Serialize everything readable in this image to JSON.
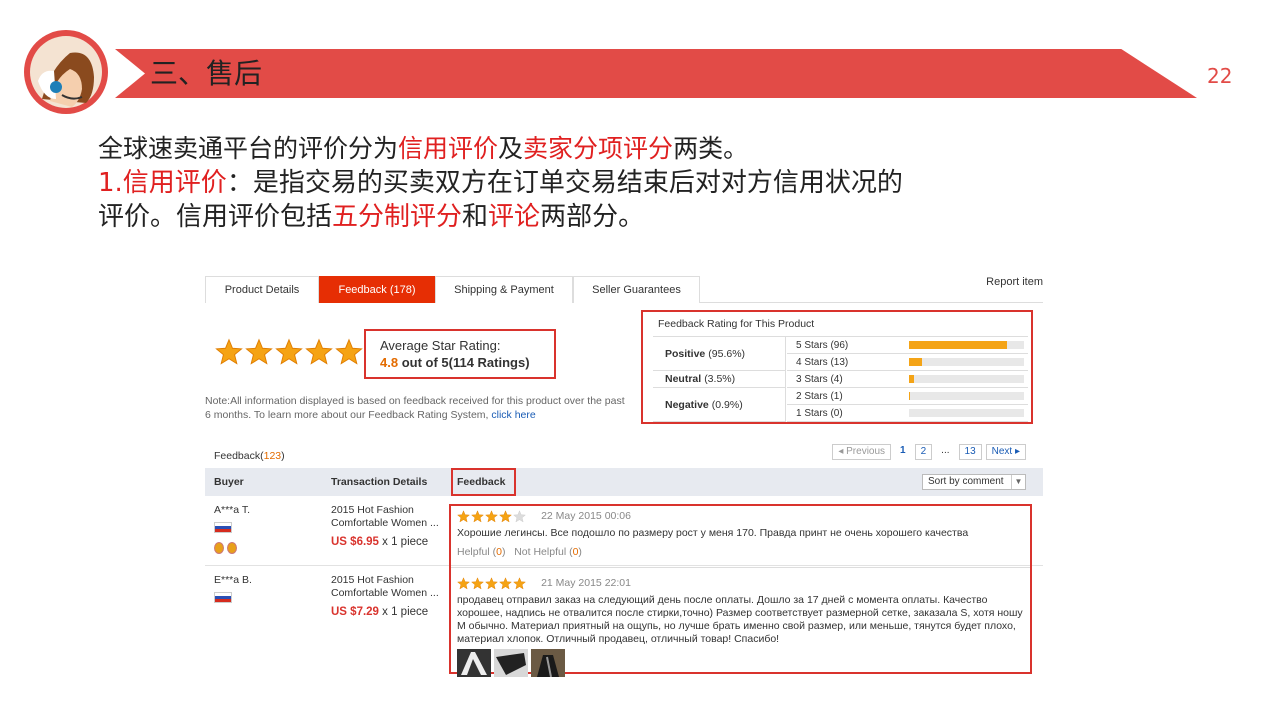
{
  "slide": {
    "title": "三、售后",
    "page_number": "22",
    "accent_color": "#e24b47"
  },
  "body": {
    "line1": [
      {
        "text": "全球速卖通平台的评价分为",
        "red": false
      },
      {
        "text": "信用评价",
        "red": true
      },
      {
        "text": "及",
        "red": false
      },
      {
        "text": "卖家分项评分",
        "red": true
      },
      {
        "text": "两类。",
        "red": false
      }
    ],
    "line2": [
      {
        "text": "1.信用评价",
        "red": true
      },
      {
        "text": "：是指交易的买卖双方在订单交易结束后对对方信用状况的",
        "red": false
      }
    ],
    "line3": [
      {
        "text": "评价。信用评价包括",
        "red": false
      },
      {
        "text": "五分制评分",
        "red": true
      },
      {
        "text": "和",
        "red": false
      },
      {
        "text": "评论",
        "red": true
      },
      {
        "text": "两部分。",
        "red": false
      }
    ]
  },
  "screenshot": {
    "tabs": [
      "Product Details",
      "Feedback (178)",
      "Shipping & Payment",
      "Seller Guarantees"
    ],
    "active_tab": 1,
    "report_link": "Report item",
    "average": {
      "label": "Average Star Rating:",
      "value": "4.8",
      "suffix": " out of 5(114 Ratings)",
      "stars": 5
    },
    "note": "Note:All information displayed is based on feedback received for this product over the past 6 months. To learn more about our Feedback Rating System, ",
    "note_link": "click here",
    "rating": {
      "title": "Feedback Rating for This Product",
      "groups": [
        {
          "name": "Positive",
          "pct": "(95.6%)"
        },
        {
          "name": "Neutral",
          "pct": "(3.5%)"
        },
        {
          "name": "Negative",
          "pct": "(0.9%)"
        }
      ],
      "stars": [
        {
          "label": "5 Stars (96)",
          "fraction": 0.85
        },
        {
          "label": "4 Stars (13)",
          "fraction": 0.11
        },
        {
          "label": "3 Stars (4)",
          "fraction": 0.04
        },
        {
          "label": "2 Stars (1)",
          "fraction": 0.01
        },
        {
          "label": "1 Stars (0)",
          "fraction": 0.0
        }
      ]
    },
    "feedback_count_label": "Feedback(",
    "feedback_count": "123",
    "feedback_count_close": ")",
    "pager": [
      "◂ Previous",
      "1",
      "2",
      "...",
      "13",
      "Next ▸"
    ],
    "columns": [
      "Buyer",
      "Transaction Details",
      "Feedback"
    ],
    "sort_label": "Sort by comment",
    "rows": [
      {
        "buyer": "A***a T.",
        "trans": "2015 Hot Fashion Comfortable Women ...",
        "price": "US $6.95",
        "qty": " x 1 piece",
        "stars": 4,
        "date": "22 May 2015 00:06",
        "text": "Хорошие легинсы. Все подошло по размеру рост у меня 170. Правда принт не очень хорошего качества",
        "helpful_label": "Helpful (",
        "helpful": "0",
        "close1": ")",
        "not_helpful_label": "Not Helpful (",
        "not_helpful": "0",
        "close2": ")"
      },
      {
        "buyer": "E***a B.",
        "trans": "2015 Hot Fashion Comfortable Women ...",
        "price": "US $7.29",
        "qty": " x 1 piece",
        "stars": 5,
        "date": "21 May 2015 22:01",
        "text": "продавец отправил заказ на следующий день после оплаты. Дошло за 17 дней с момента оплаты. Качество хорошее, надпись не отвалится после стирки,точно) Размер соответствует размерной сетке, заказала S, хотя ношу M обычно. Материал приятный на ощупь, но лучше брать именно свой размер, или меньше, тянутся будет плохо, материал хлопок. Отличный продавец, отличный товар! Спасибо!"
      }
    ]
  }
}
